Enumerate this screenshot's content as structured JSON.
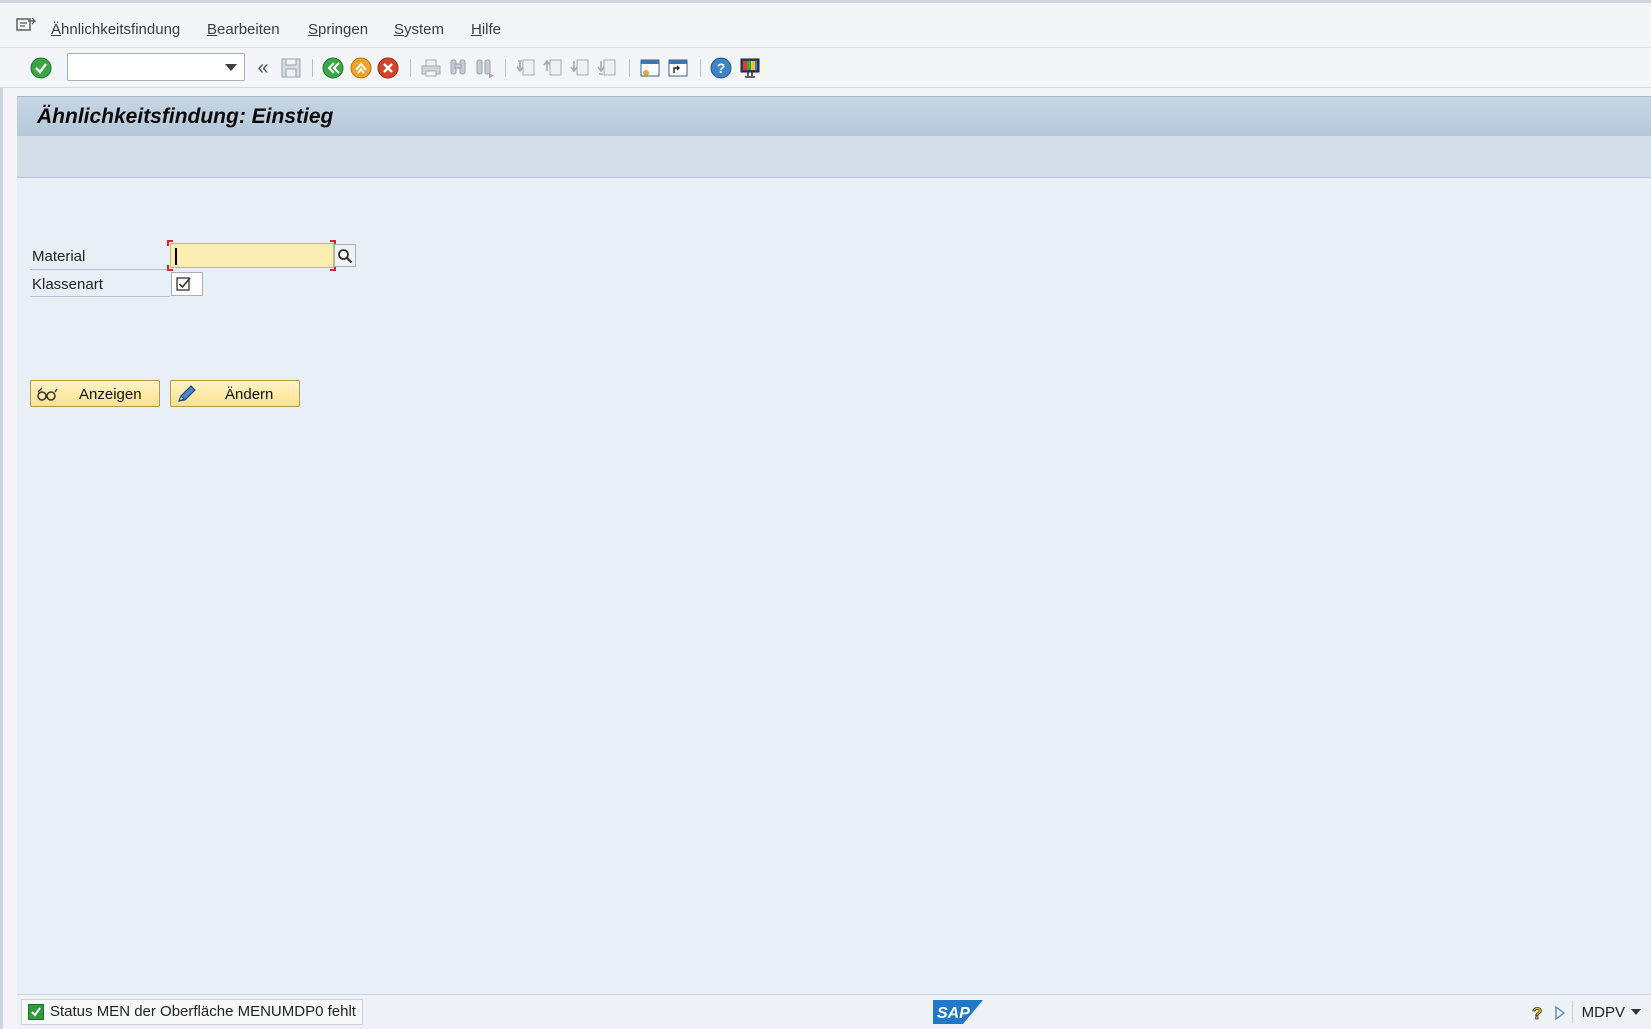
{
  "menubar": {
    "items": [
      {
        "label": "Ähnlichkeitsfindung",
        "mnemonic": "Ä"
      },
      {
        "label": "Bearbeiten",
        "mnemonic": "B"
      },
      {
        "label": "Springen",
        "mnemonic": "S"
      },
      {
        "label": "System",
        "mnemonic": "S"
      },
      {
        "label": "Hilfe",
        "mnemonic": "H"
      }
    ]
  },
  "toolbar": {
    "command_field": {
      "value": "",
      "placeholder": ""
    },
    "icons": [
      "enter-icon",
      "save-icon",
      "back-icon",
      "exit-icon",
      "cancel-icon",
      "print-icon",
      "find-icon",
      "find-next-icon",
      "first-page-icon",
      "previous-page-icon",
      "next-page-icon",
      "last-page-icon",
      "create-session-icon",
      "shortcut-icon",
      "help-icon",
      "customize-layout-icon"
    ]
  },
  "screen": {
    "title": "Ähnlichkeitsfindung: Einstieg"
  },
  "form": {
    "material_label": "Material",
    "material_value": "",
    "klassenart_label": "Klassenart",
    "klassenart_checked": true
  },
  "buttons": {
    "display_label": "Anzeigen",
    "change_label": "Ändern"
  },
  "status": {
    "message": "Status MEN der Oberfläche MENUMDP0 fehlt",
    "type": "success",
    "system": "MDPV"
  },
  "colors": {
    "title_bg": "#b5c7d9",
    "content_bg": "#e9eff6",
    "required_field": "#fbedb1",
    "button_bg": "#fbe28c",
    "ok_green": "#2f9a3e",
    "cancel_red": "#d2452a",
    "exit_orange": "#f0a32a"
  }
}
